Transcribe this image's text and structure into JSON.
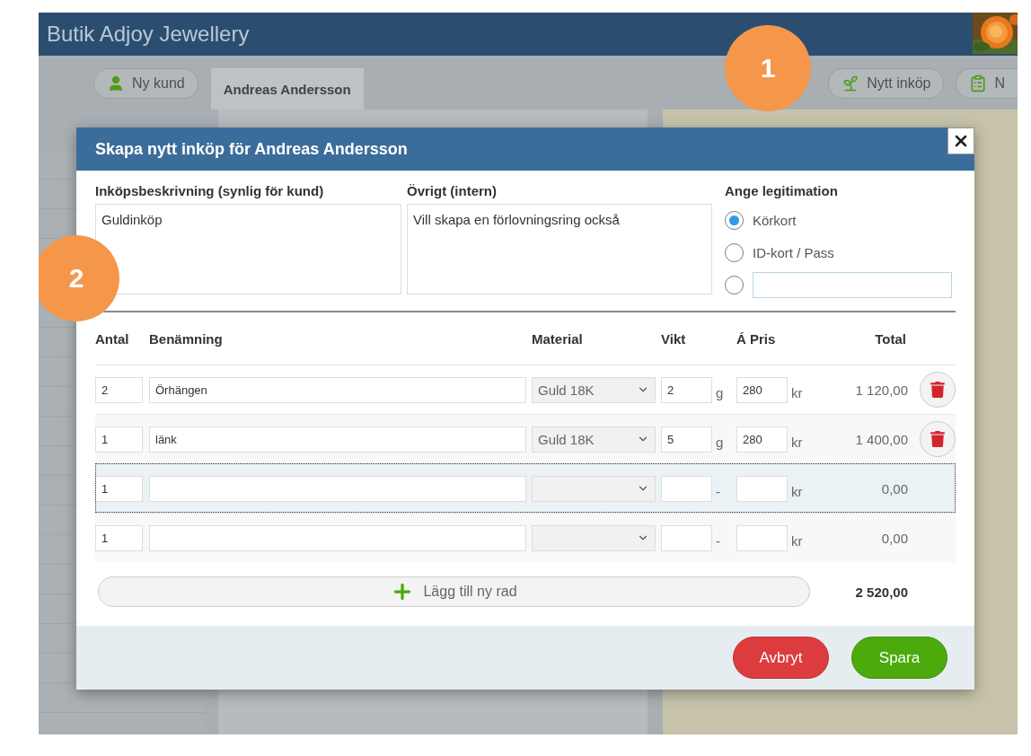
{
  "app": {
    "title": "Butik Adjoy Jewellery",
    "new_customer_button": "Ny kund",
    "tabs": [
      {
        "label": "Andreas Andersson",
        "selected": true
      }
    ],
    "toolbar_buttons": [
      {
        "label": "Nytt inköp",
        "kind": "purchase"
      },
      {
        "label": "N",
        "kind": "list"
      }
    ]
  },
  "callouts": [
    "1",
    "2"
  ],
  "dialog": {
    "title": "Skapa nytt inköp för Andreas Andersson",
    "description": {
      "label": "Inköpsbeskrivning (synlig för kund)",
      "value": "Guldinköp"
    },
    "notes": {
      "label": "Övrigt (intern)",
      "value": "Vill skapa en förlovningsring också"
    },
    "id_type": {
      "label": "Ange legitimation",
      "options": [
        {
          "kind": "radio",
          "label": "Körkort",
          "selected": true
        },
        {
          "kind": "radio",
          "label": "ID-kort / Pass",
          "selected": false
        },
        {
          "kind": "radio-field",
          "selected": false
        }
      ]
    },
    "columns": [
      "Antal",
      "Benämning",
      "Material",
      "Vikt",
      "Á Pris",
      "Total"
    ],
    "rows": [
      {
        "qty": "2",
        "name": "Örhängen",
        "material": "Guld 18K",
        "weight": "2",
        "weight_unit": "g",
        "price": "280",
        "price_unit": "kr",
        "total": "1 120,00",
        "deletable": true,
        "focused": false
      },
      {
        "qty": "1",
        "name": "länk",
        "material": "Guld 18K",
        "weight": "5",
        "weight_unit": "g",
        "price": "280",
        "price_unit": "kr",
        "total": "1 400,00",
        "deletable": true,
        "focused": false
      },
      {
        "qty": "1",
        "weight_unit": "-",
        "price_unit": "kr",
        "total": "0,00",
        "deletable": false,
        "focused": true
      },
      {
        "qty": "1",
        "weight_unit": "-",
        "price_unit": "kr",
        "total": "0,00",
        "deletable": false,
        "focused": false
      }
    ],
    "add_row": "Lägg till ny rad",
    "grand_total": "2 520,00",
    "buttons": [
      {
        "label": "Avbryt",
        "kind": "cancel"
      },
      {
        "label": "Spara",
        "kind": "save"
      }
    ]
  }
}
